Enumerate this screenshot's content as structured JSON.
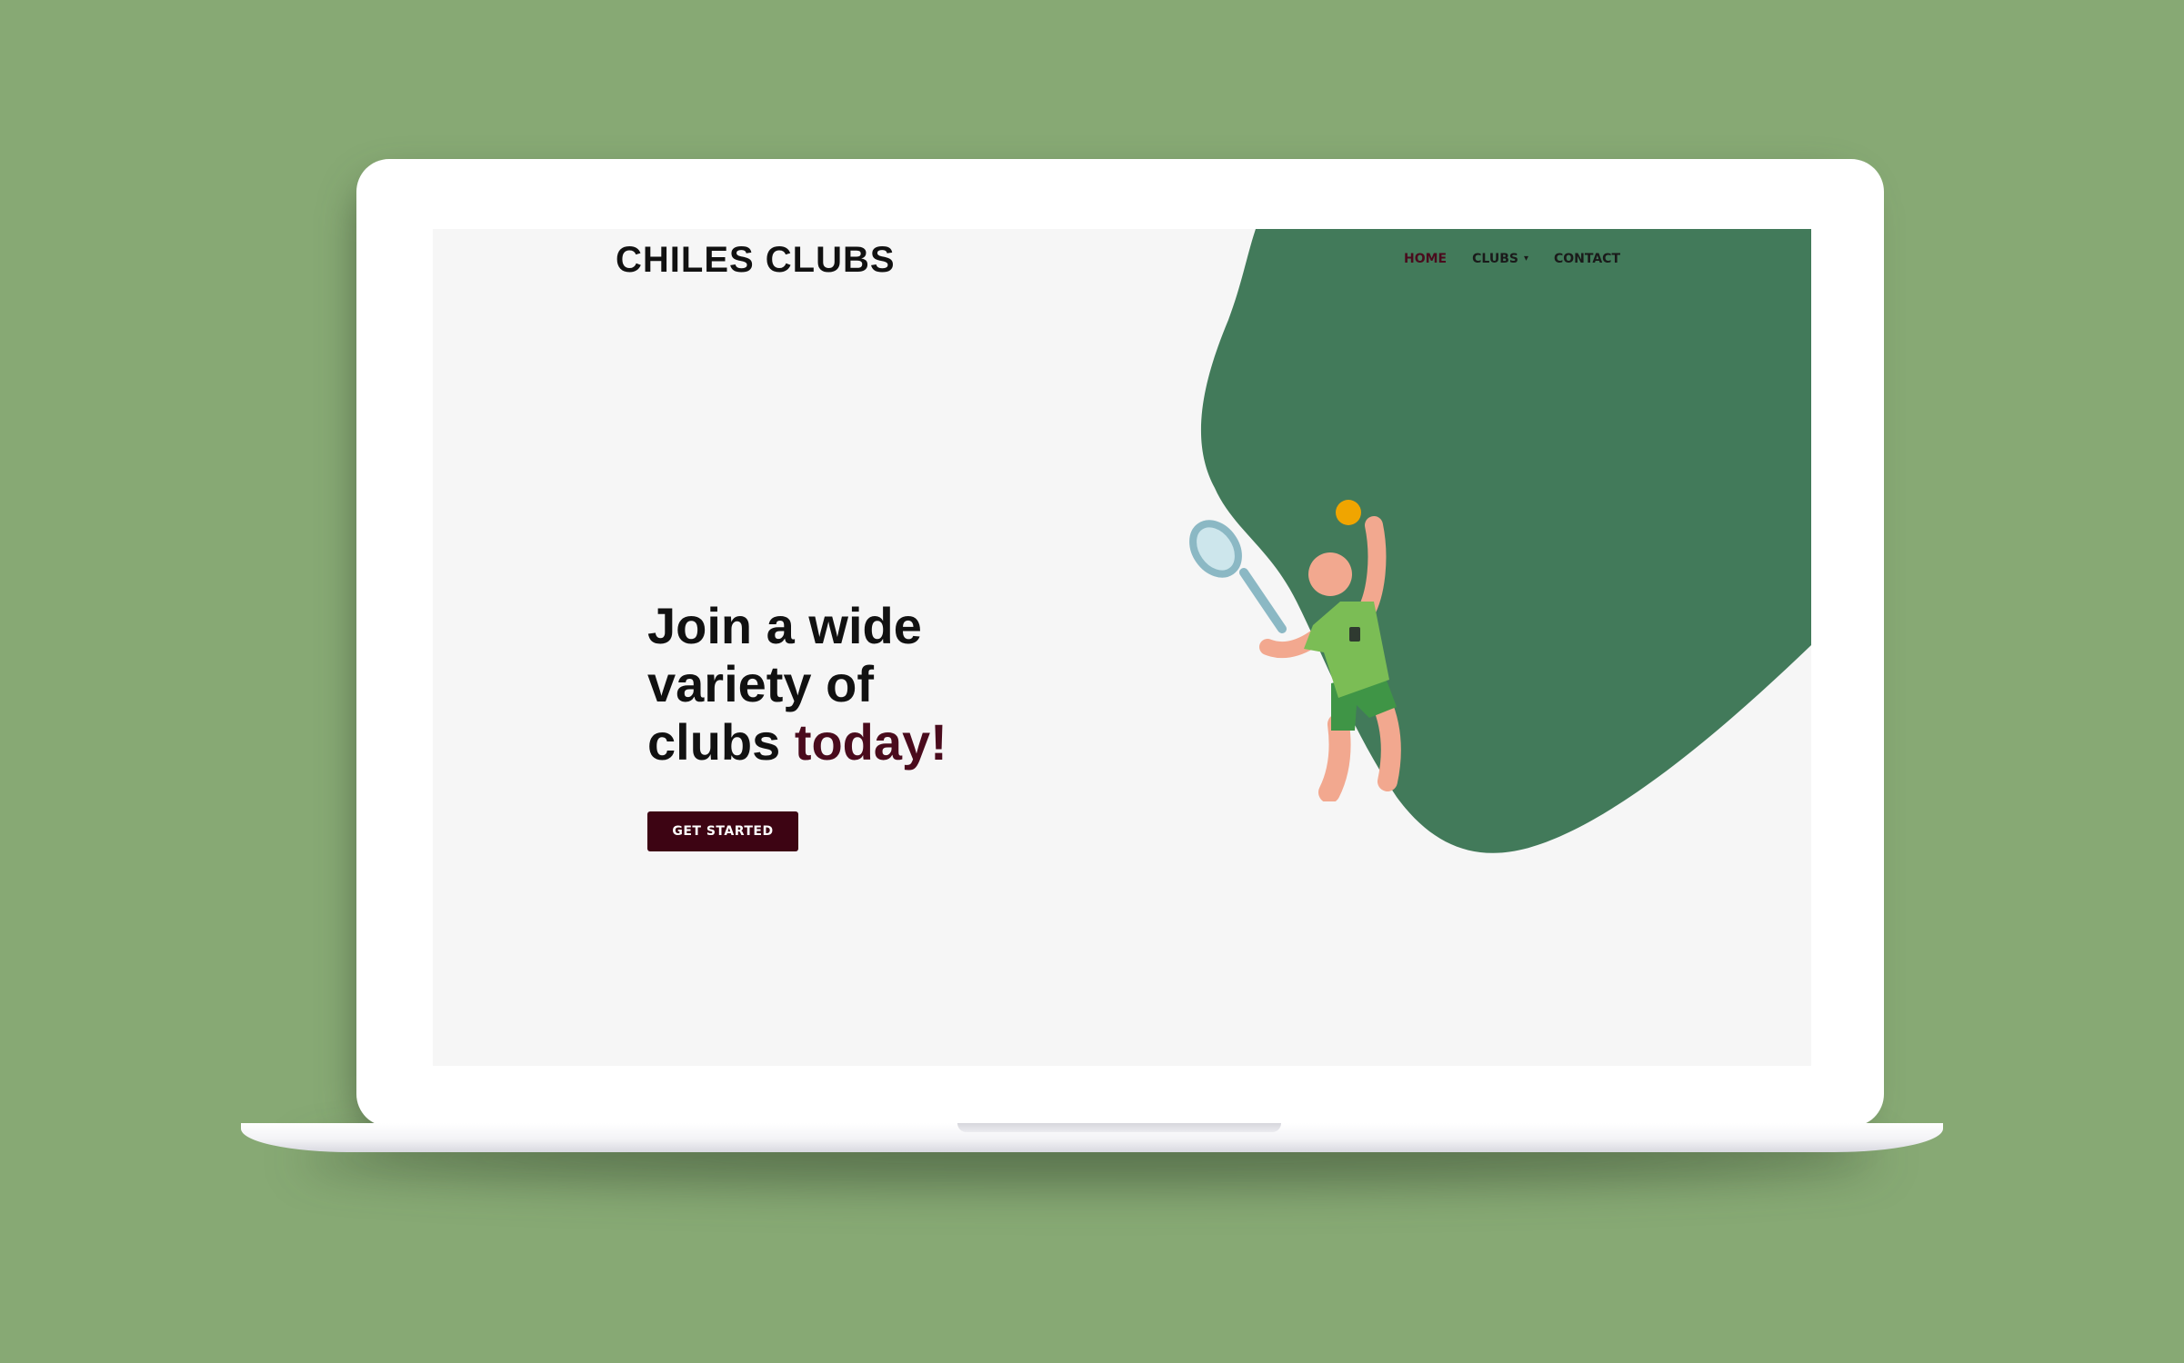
{
  "site": {
    "logo": "CHILES CLUBS"
  },
  "nav": {
    "items": [
      {
        "label": "HOME",
        "active": true
      },
      {
        "label": "CLUBS",
        "has_dropdown": true
      },
      {
        "label": "CONTACT"
      }
    ],
    "dropdown_icon": "chevron-down-icon"
  },
  "hero": {
    "line1": "Join a wide",
    "line2": "variety of",
    "line3_prefix": "clubs ",
    "line3_accent": "today!",
    "cta_label": "GET STARTED"
  },
  "colors": {
    "background": "#87a974",
    "screen": "#f6f6f6",
    "blob": "#427a5a",
    "accent": "#4a0b1d",
    "button": "#3d0413"
  }
}
